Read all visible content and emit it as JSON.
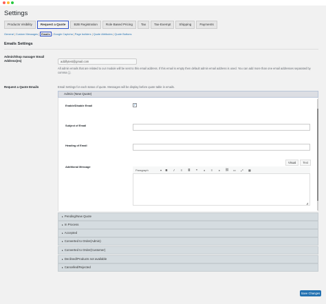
{
  "page_title": "Settings",
  "tabs": [
    {
      "label": "Products Visibility"
    },
    {
      "label": "Request a Quote"
    },
    {
      "label": "B2B Registration"
    },
    {
      "label": "Role Based Pricing"
    },
    {
      "label": "Tax"
    },
    {
      "label": "Tax-Exempt"
    },
    {
      "label": "Shipping"
    },
    {
      "label": "Payments"
    }
  ],
  "subnav": [
    {
      "label": "General"
    },
    {
      "label": "Custom Messages"
    },
    {
      "label": "Emails"
    },
    {
      "label": "Google Captcha"
    },
    {
      "label": "Page builders"
    },
    {
      "label": "Quote Attributes"
    },
    {
      "label": "Quote Buttons"
    }
  ],
  "section_title": "Emails Settings",
  "admin_email": {
    "label": "Admin/Shop manager Email Address(es)",
    "value": "addifytest@gmail.com",
    "description": "All admin emails that are related to our module will be sent to this email address. If this email is empty then default admin email address is used. You can add more than one email addresses separated by comma (,)."
  },
  "quote_emails": {
    "label": "Request a Quote Emails",
    "description": "Email Settings for each status of quote. Messages will be display before quote table in emails."
  },
  "open_accordion": {
    "title": "Admin (New Quote)",
    "enable_label": "Enable/Disable Email",
    "enabled": true,
    "subject_label": "Subject of Email",
    "heading_label": "Heading of Email",
    "message_label": "Additional Message"
  },
  "editor": {
    "tab_visual": "Visual",
    "tab_text": "Text",
    "format": "Paragraph",
    "tools": [
      "B",
      "I",
      "≡",
      "≣",
      "❝",
      "⫷",
      "≡",
      "⫸",
      "⛓",
      "▭",
      "⤢",
      "▦"
    ]
  },
  "accordions": [
    {
      "title": "Pending/New Quote"
    },
    {
      "title": "In Process"
    },
    {
      "title": "Accepted"
    },
    {
      "title": "Converted to Order(Admin)"
    },
    {
      "title": "Converted to Order(Customer)"
    },
    {
      "title": "Declined/Products not available"
    },
    {
      "title": "Cancelled/Rejected"
    }
  ],
  "save_button": "Save Changes",
  "colors": {
    "accent": "#2271b1",
    "active_outline": "#2d4fc9"
  }
}
